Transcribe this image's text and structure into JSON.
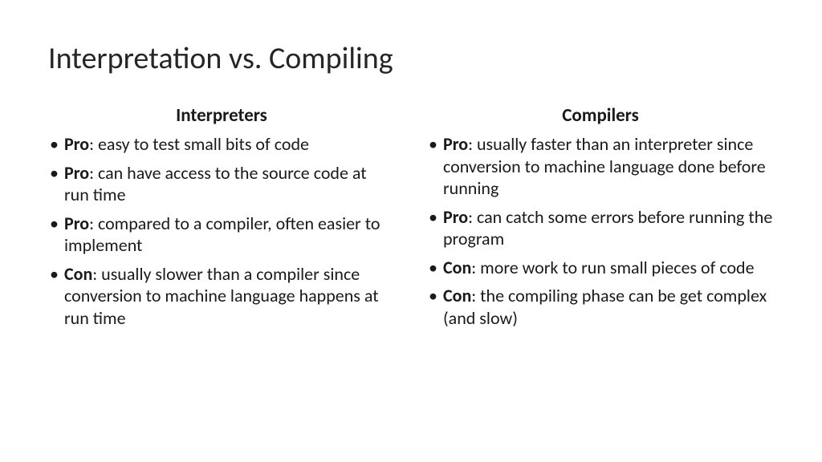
{
  "title": "Interpretation vs. Compiling",
  "columns": {
    "left": {
      "heading": "Interpreters",
      "items": [
        {
          "tag": "Pro",
          "text": ": easy to test small bits of code"
        },
        {
          "tag": "Pro",
          "text": ": can have access to the source code at run time"
        },
        {
          "tag": "Pro",
          "text": ": compared to a compiler, often easier to implement"
        },
        {
          "tag": "Con",
          "text": ": usually slower than a compiler since conversion to machine language happens at run time"
        }
      ]
    },
    "right": {
      "heading": "Compilers",
      "items": [
        {
          "tag": "Pro",
          "text": ": usually faster than an interpreter since conversion to machine language done before running"
        },
        {
          "tag": "Pro",
          "text": ": can catch some errors before running the program"
        },
        {
          "tag": "Con",
          "text": ": more work to run small pieces of code"
        },
        {
          "tag": "Con",
          "text": ": the compiling phase can be get complex (and slow)"
        }
      ]
    }
  }
}
